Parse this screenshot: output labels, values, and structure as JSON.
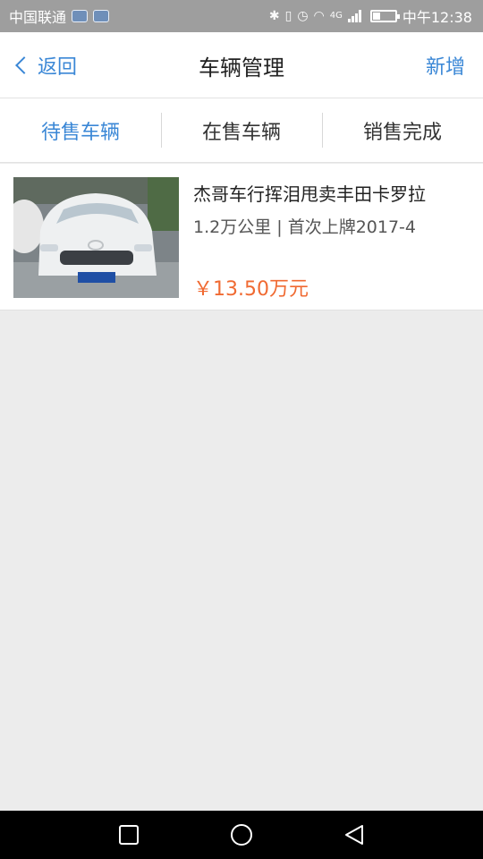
{
  "status_bar": {
    "carrier": "中国联通",
    "time": "中午12:38",
    "network": "4G"
  },
  "header": {
    "back_label": "返回",
    "title": "车辆管理",
    "add_label": "新增"
  },
  "tabs": [
    {
      "label": "待售车辆",
      "active": true
    },
    {
      "label": "在售车辆",
      "active": false
    },
    {
      "label": "销售完成",
      "active": false
    }
  ],
  "vehicles": [
    {
      "name": "杰哥车行挥泪甩卖丰田卡罗拉",
      "meta": "1.2万公里 | 首次上牌2017-4",
      "price": "￥13.50万元"
    }
  ],
  "colors": {
    "accent": "#3a87d6",
    "price": "#f06a32",
    "background": "#ececec"
  },
  "icons": {
    "back": "chevron-left-icon",
    "nav_recents": "square-icon",
    "nav_home": "circle-icon",
    "nav_back": "triangle-back-icon"
  }
}
